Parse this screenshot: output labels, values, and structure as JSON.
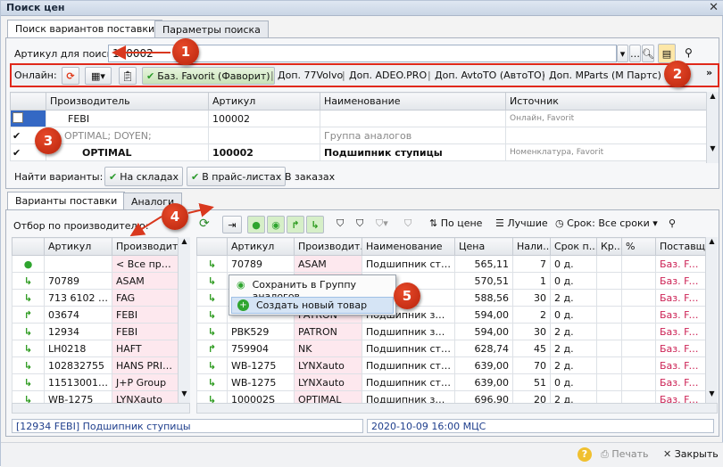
{
  "window": {
    "title": "Поиск цен"
  },
  "top_tabs": [
    "Поиск вариантов поставки",
    "Параметры поиска"
  ],
  "search": {
    "label": "Артикул для поиска:",
    "value": "100002"
  },
  "online_bar": {
    "label": "Онлайн:",
    "buttons": [
      "Баз. Favorit (Фаворит)",
      "Доп. 77Volvo",
      "Доп. ADEO.PRO",
      "Доп. AvtoTO (АвтоТО)",
      "Доп. MParts (М Партс)"
    ]
  },
  "top_grid": {
    "columns": [
      "Производитель",
      "Артикул",
      "Наименование",
      "Источник"
    ],
    "rows": [
      {
        "maker": "FEBI",
        "article": "100002",
        "name": "",
        "source": "Онлайн, Favorit"
      },
      {
        "maker": "OPTIMAL; DOYEN;",
        "article": "",
        "name": "Группа аналогов",
        "source": ""
      },
      {
        "maker": "OPTIMAL",
        "article": "100002",
        "name": "Подшипник ступицы",
        "source": "Номенклатура, Favorit"
      }
    ]
  },
  "find_variants": {
    "label": "Найти варианты:",
    "in_stock": "На складах",
    "in_pricelists": "В прайс-листах",
    "in_orders": "В заказах"
  },
  "bottom_tabs": [
    "Варианты поставки",
    "Аналоги"
  ],
  "filter_label": "Отбор по производителю:",
  "toolbar": {
    "by_price": "По цене",
    "best": "Лучшие",
    "term": "Срок: Все сроки"
  },
  "left_grid": {
    "columns": [
      "Артикул",
      "Производит..."
    ],
    "rows": [
      {
        "icon": "dot",
        "article": "",
        "maker": "< Все пред..."
      },
      {
        "icon": "arrow",
        "article": "70789",
        "maker": "ASAM"
      },
      {
        "icon": "arrow",
        "article": "713 6102 30",
        "maker": "FAG"
      },
      {
        "icon": "arrow-up",
        "article": "03674",
        "maker": "FEBI"
      },
      {
        "icon": "arrow",
        "article": "12934",
        "maker": "FEBI"
      },
      {
        "icon": "arrow",
        "article": "LH0218",
        "maker": "HAFT"
      },
      {
        "icon": "arrow",
        "article": "102832755",
        "maker": "HANS PRIES"
      },
      {
        "icon": "arrow",
        "article": "1151300110",
        "maker": "J+P Group"
      },
      {
        "icon": "arrow",
        "article": "WB-1275",
        "maker": "LYNXauto"
      }
    ]
  },
  "right_grid": {
    "columns": [
      "Артикул",
      "Производит...",
      "Наименование",
      "Цена",
      "Нали...",
      "Срок п...",
      "Кр...",
      "%",
      "Поставщ..."
    ],
    "rows": [
      {
        "icon": "arrow",
        "article": "70789",
        "maker": "ASAM",
        "name": "Подшипник ступи...",
        "price": "565,11",
        "qty": "7",
        "term": "0 д.",
        "supplier": "Баз. Favo"
      },
      {
        "icon": "arrow",
        "article": "",
        "maker": "",
        "name": "",
        "price": "570,51",
        "qty": "1",
        "term": "0 д.",
        "supplier": "Баз. Favo"
      },
      {
        "icon": "arrow",
        "article": "",
        "maker": "",
        "name": "т по...",
        "price": "588,56",
        "qty": "30",
        "term": "2 д.",
        "supplier": "Баз. Favo"
      },
      {
        "icon": "arrow",
        "article": "",
        "maker": "PATRON",
        "name": "Подшипник задн...",
        "price": "594,00",
        "qty": "2",
        "term": "0 д.",
        "supplier": "Баз. Favo"
      },
      {
        "icon": "arrow",
        "article": "PBK529",
        "maker": "PATRON",
        "name": "Подшипник задн...",
        "price": "594,00",
        "qty": "30",
        "term": "2 д.",
        "supplier": "Баз. Favo"
      },
      {
        "icon": "arrow-up",
        "article": "759904",
        "maker": "NK",
        "name": "Подшипник ступи...",
        "price": "628,74",
        "qty": "45",
        "term": "2 д.",
        "supplier": "Баз. Favo"
      },
      {
        "icon": "arrow",
        "article": "WB-1275",
        "maker": "LYNXauto",
        "name": "Подшипник ступи...",
        "price": "639,00",
        "qty": "70",
        "term": "2 д.",
        "supplier": "Баз. Favo"
      },
      {
        "icon": "arrow",
        "article": "WB-1275",
        "maker": "LYNXauto",
        "name": "Подшипник ступи...",
        "price": "639,00",
        "qty": "51",
        "term": "0 д.",
        "supplier": "Баз. Favo"
      },
      {
        "icon": "arrow",
        "article": "100002S",
        "maker": "OPTIMAL",
        "name": "Подшипник зад.с...",
        "price": "696,90",
        "qty": "20",
        "term": "2 д.",
        "supplier": "Баз. Favo"
      }
    ]
  },
  "context_menu": [
    "Сохранить в Группу аналогов",
    "Создать новый товар"
  ],
  "status": {
    "left": "[12934 FEBI]  Подшипник ступицы",
    "right": "2020-10-09 16:00  МЦС"
  },
  "footer": {
    "print": "Печать",
    "close": "Закрыть"
  },
  "markers": [
    "1",
    "2",
    "3",
    "4",
    "5"
  ],
  "colors": {
    "marker": "#d9381e",
    "highlight_box": "#e0281a",
    "pink_cell": "#fde8ee",
    "supplier_text": "#cc2255"
  }
}
